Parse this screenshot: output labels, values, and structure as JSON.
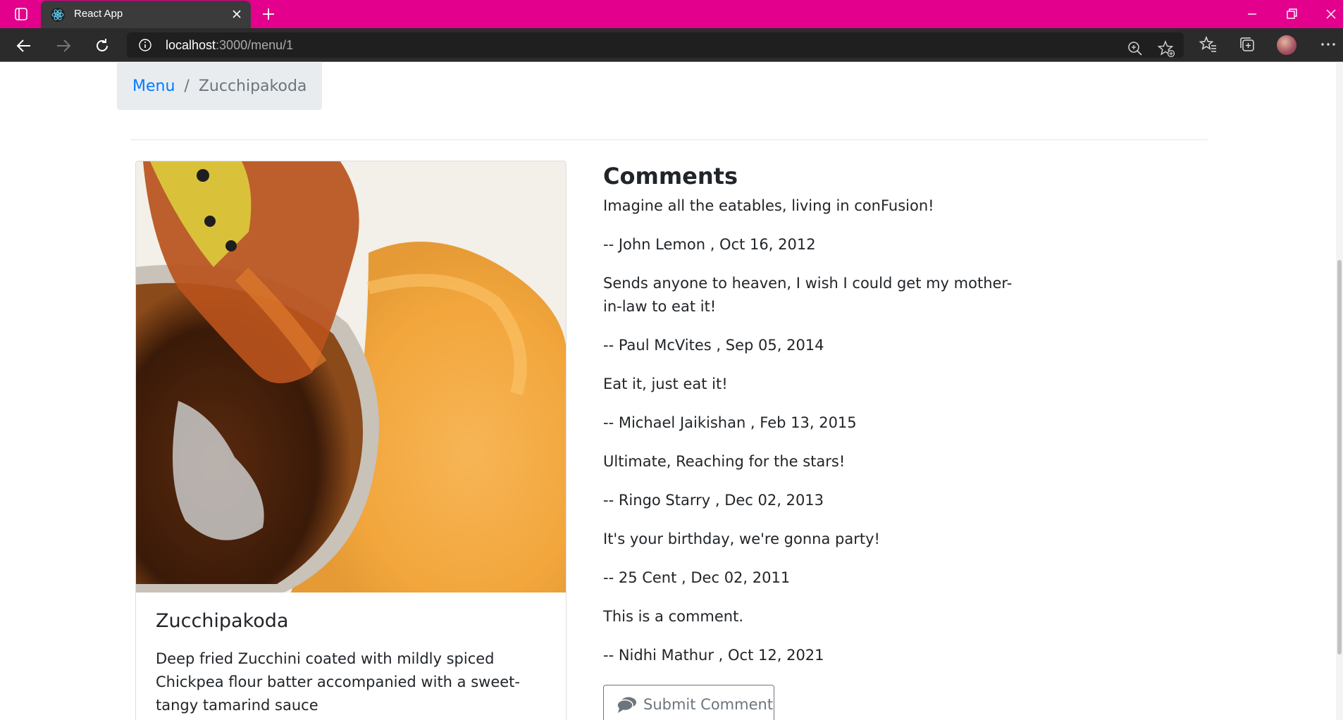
{
  "browser": {
    "tab_title": "React App",
    "url_host": "localhost",
    "url_rest": ":3000/menu/1"
  },
  "breadcrumb": {
    "link": "Menu",
    "separator": "/",
    "active": "Zucchipakoda"
  },
  "dish": {
    "name": "Zucchipakoda",
    "description": "Deep fried Zucchini coated with mildly spiced Chickpea flour batter accompanied with a sweet-tangy tamarind sauce"
  },
  "comments": {
    "heading": "Comments",
    "items": [
      {
        "comment": "Imagine all the eatables, living in conFusion!",
        "byline": "-- John Lemon , Oct 16, 2012"
      },
      {
        "comment": "Sends anyone to heaven, I wish I could get my mother-in-law to eat it!",
        "byline": "-- Paul McVites , Sep 05, 2014"
      },
      {
        "comment": "Eat it, just eat it!",
        "byline": "-- Michael Jaikishan , Feb 13, 2015"
      },
      {
        "comment": "Ultimate, Reaching for the stars!",
        "byline": "-- Ringo Starry , Dec 02, 2013"
      },
      {
        "comment": "It's your birthday, we're gonna party!",
        "byline": "-- 25 Cent , Dec 02, 2011"
      },
      {
        "comment": "This is a comment.",
        "byline": "-- Nidhi Mathur , Oct 12, 2021"
      }
    ],
    "submit_label": "Submit Comment"
  },
  "colors": {
    "titlebar": "#e3008c",
    "toolbar": "#2b2b2b",
    "link": "#007bff",
    "breadcrumb_bg": "#e9ecef",
    "muted": "#6c757d"
  }
}
